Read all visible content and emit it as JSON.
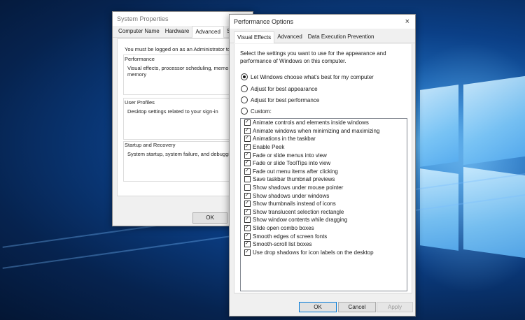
{
  "system_properties": {
    "title": "System Properties",
    "tabs": [
      "Computer Name",
      "Hardware",
      "Advanced",
      "Syst"
    ],
    "admin_note": "You must be logged on as an Administrator to",
    "performance": {
      "heading": "Performance",
      "description": "Visual effects, processor scheduling, memo",
      "description_line2": "memory"
    },
    "user_profiles": {
      "heading": "User Profiles",
      "description": "Desktop settings related to your sign-in"
    },
    "startup_recovery": {
      "heading": "Startup and Recovery",
      "description": "System startup, system failure, and debuggi"
    },
    "ok_label": "OK"
  },
  "performance_options": {
    "title": "Performance Options",
    "close_label": "×",
    "tabs": [
      "Visual Effects",
      "Advanced",
      "Data Execution Prevention"
    ],
    "intro": "Select the settings you want to use for the appearance and performance of Windows on this computer.",
    "radios": [
      {
        "label": "Let Windows choose what's best for my computer",
        "selected": true
      },
      {
        "label": "Adjust for best appearance",
        "selected": false
      },
      {
        "label": "Adjust for best performance",
        "selected": false
      },
      {
        "label": "Custom:",
        "selected": false
      }
    ],
    "effects": [
      {
        "label": "Animate controls and elements inside windows",
        "checked": true
      },
      {
        "label": "Animate windows when minimizing and maximizing",
        "checked": true
      },
      {
        "label": "Animations in the taskbar",
        "checked": true
      },
      {
        "label": "Enable Peek",
        "checked": true
      },
      {
        "label": "Fade or slide menus into view",
        "checked": true
      },
      {
        "label": "Fade or slide ToolTips into view",
        "checked": true
      },
      {
        "label": "Fade out menu items after clicking",
        "checked": true
      },
      {
        "label": "Save taskbar thumbnail previews",
        "checked": false
      },
      {
        "label": "Show shadows under mouse pointer",
        "checked": false
      },
      {
        "label": "Show shadows under windows",
        "checked": true
      },
      {
        "label": "Show thumbnails instead of icons",
        "checked": true
      },
      {
        "label": "Show translucent selection rectangle",
        "checked": true
      },
      {
        "label": "Show window contents while dragging",
        "checked": true
      },
      {
        "label": "Slide open combo boxes",
        "checked": true
      },
      {
        "label": "Smooth edges of screen fonts",
        "checked": true
      },
      {
        "label": "Smooth-scroll list boxes",
        "checked": true
      },
      {
        "label": "Use drop shadows for icon labels on the desktop",
        "checked": true
      }
    ],
    "buttons": {
      "ok": "OK",
      "cancel": "Cancel",
      "apply": "Apply"
    }
  }
}
